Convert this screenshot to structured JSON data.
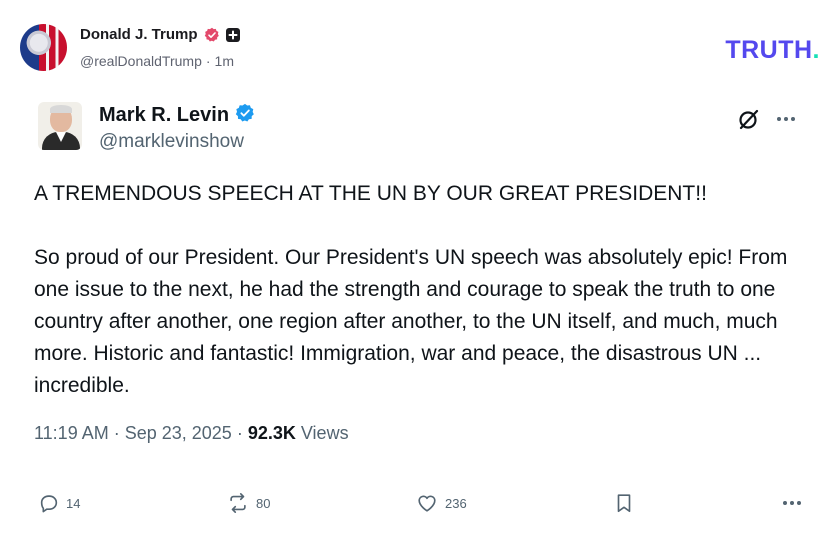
{
  "truth_header": {
    "author_name": "Donald J. Trump",
    "handle": "@realDonaldTrump",
    "separator": "·",
    "time_ago": "1m",
    "logo_text": "TRUTH",
    "logo_dot": ".",
    "colors": {
      "logo": "#5448ee",
      "logo_dot": "#17e0b6",
      "verified": "#e3496b"
    }
  },
  "post": {
    "author_name": "Mark R. Levin",
    "handle": "@marklevinshow",
    "text": "A TREMENDOUS SPEECH AT THE UN BY OUR GREAT PRESIDENT!!\n\nSo proud of our President.  Our President's UN speech was absolutely epic!  From one issue to the next, he had the strength and courage to speak the truth to one country after another, one region after another, to the UN itself, and much, much more.  Historic and fantastic!  Immigration, war and peace, the disastrous UN ... incredible.",
    "time": "11:19 AM",
    "date": "Sep 23, 2025",
    "dot": "·",
    "views_count": "92.3K",
    "views_label": "Views",
    "colors": {
      "verified": "#1d9bf0",
      "muted": "#536471"
    },
    "icons": {
      "grok": "grok-icon",
      "more": "more-horizontal-icon",
      "reply": "reply-icon",
      "repost": "repost-icon",
      "like": "heart-icon",
      "bookmark": "bookmark-icon",
      "share_more": "more-horizontal-icon"
    },
    "actions": {
      "replies": "14",
      "reposts": "80",
      "likes": "236"
    }
  }
}
